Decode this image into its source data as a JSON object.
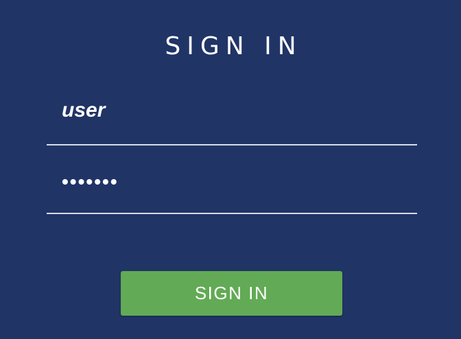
{
  "login": {
    "title": "SIGN IN",
    "username_value": "user",
    "password_value": "•••••••",
    "submit_label": "SIGN IN"
  },
  "colors": {
    "background": "#203466",
    "button": "#62aa55",
    "text": "#ffffff",
    "underline": "#d8dde8"
  }
}
